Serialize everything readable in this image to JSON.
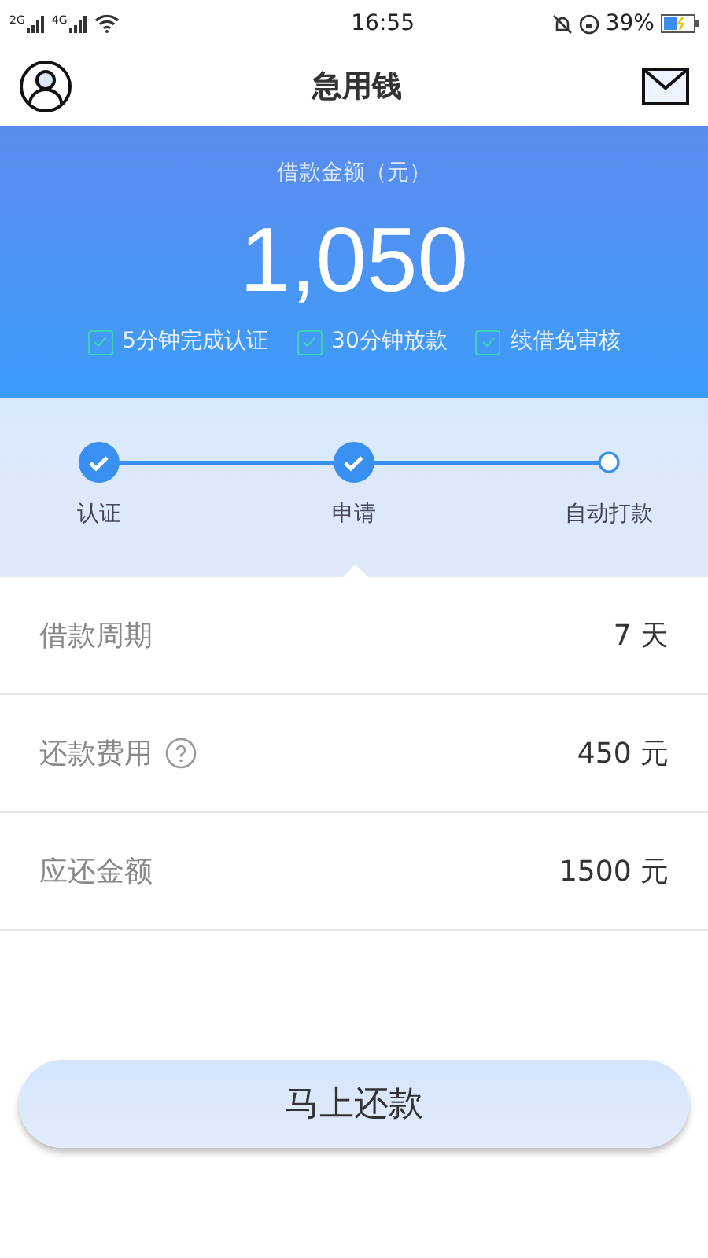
{
  "status_bar": {
    "networks": [
      "2G",
      "4G"
    ],
    "time": "16:55",
    "battery": "39%"
  },
  "header": {
    "title": "急用钱"
  },
  "amount": {
    "label": "借款金额（元）",
    "value": "1,050",
    "features": [
      {
        "label": "5分钟完成认证",
        "checked": true
      },
      {
        "label": "30分钟放款",
        "checked": true
      },
      {
        "label": "续借免审核",
        "checked": true
      }
    ]
  },
  "steps": [
    {
      "label": "认证",
      "done": true
    },
    {
      "label": "申请",
      "done": true
    },
    {
      "label": "自动打款",
      "done": false
    }
  ],
  "rows": [
    {
      "label": "借款周期",
      "value": "7 天",
      "help": false
    },
    {
      "label": "还款费用",
      "value": "450 元",
      "help": true
    },
    {
      "label": "应还金额",
      "value": "1500 元",
      "help": false
    }
  ],
  "button": {
    "label": "马上还款"
  }
}
